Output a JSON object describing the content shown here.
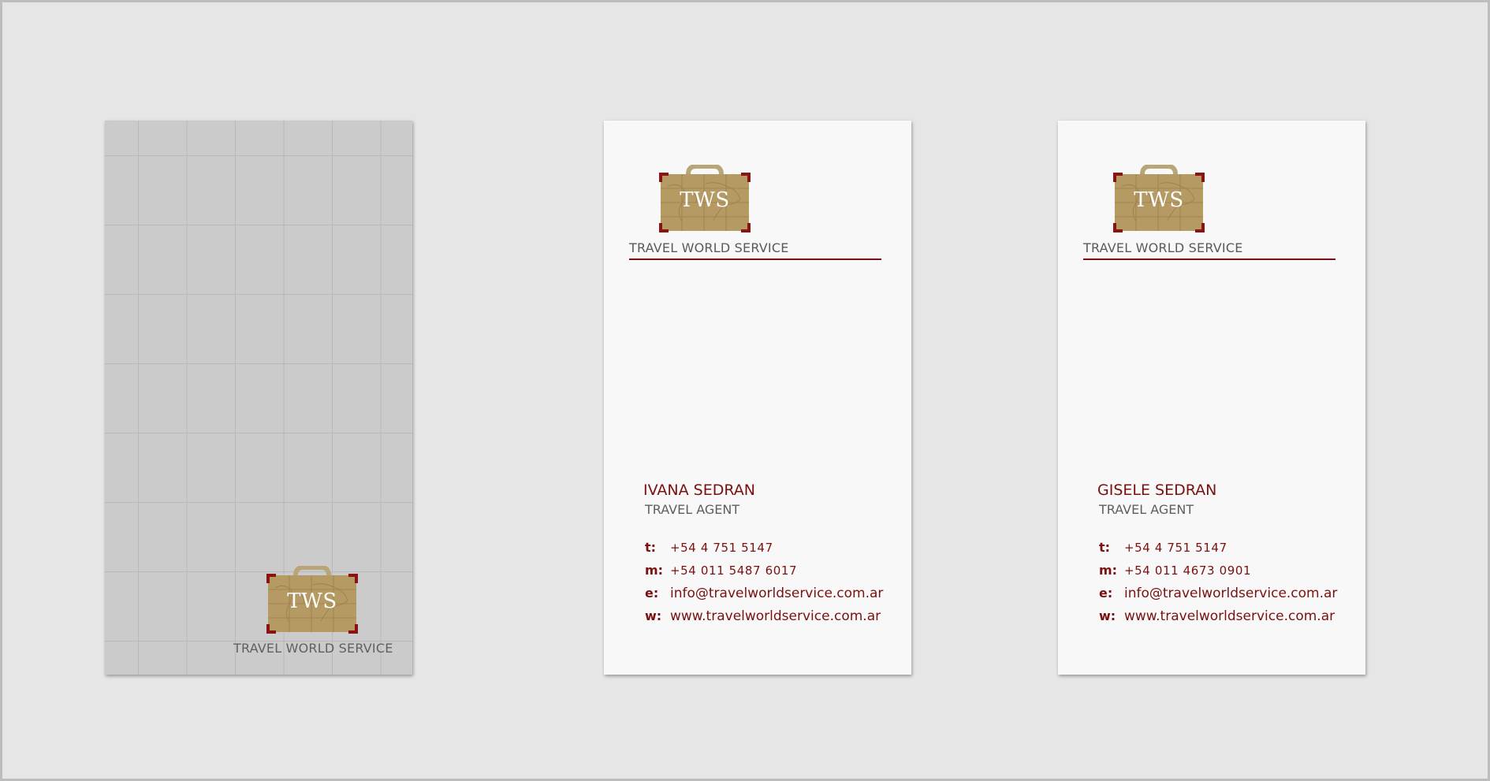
{
  "brand": {
    "monogram": "TWS",
    "name": "TRAVEL WORLD SERVICE",
    "accent_color": "#7a1010",
    "suitcase_color": "#b59a63"
  },
  "cards": [
    {
      "name": "IVANA SEDRAN",
      "role": "TRAVEL AGENT",
      "contacts": {
        "t_label": "t:",
        "t": "+54  4  751  5147",
        "m_label": "m:",
        "m": "+54  011  5487  6017",
        "e_label": "e:",
        "e": "info@travelworldservice.com.ar",
        "w_label": "w:",
        "w": "www.travelworldservice.com.ar"
      }
    },
    {
      "name": "GISELE SEDRAN",
      "role": "TRAVEL AGENT",
      "contacts": {
        "t_label": "t:",
        "t": "+54  4  751  5147",
        "m_label": "m:",
        "m": "+54  011  4673  0901",
        "e_label": "e:",
        "e": "info@travelworldservice.com.ar",
        "w_label": "w:",
        "w": "www.travelworldservice.com.ar"
      }
    }
  ]
}
